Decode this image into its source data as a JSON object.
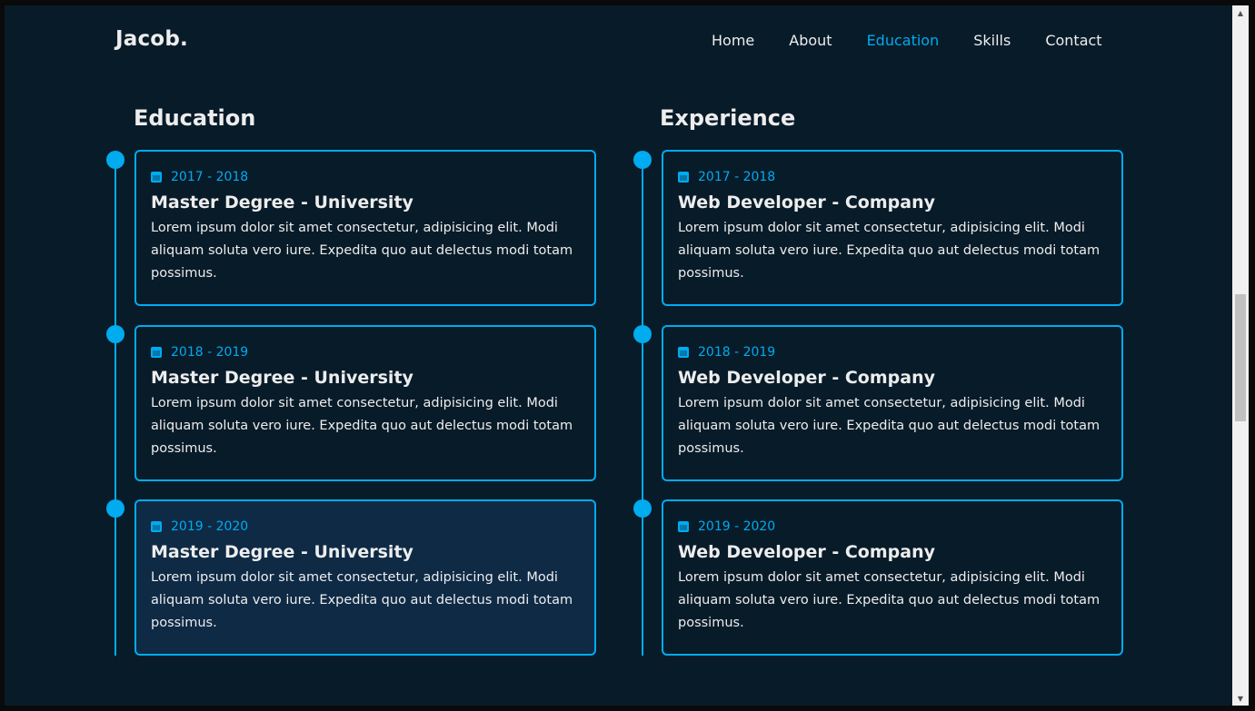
{
  "header": {
    "logo": "Jacob.",
    "nav": [
      "Home",
      "About",
      "Education",
      "Skills",
      "Contact"
    ],
    "active": "Education"
  },
  "education": {
    "title": "Education",
    "items": [
      {
        "year": "2017 - 2018",
        "title": "Master Degree - University",
        "desc": "Lorem ipsum dolor sit amet consectetur, adipisicing elit. Modi aliquam soluta vero iure. Expedita quo aut delectus modi totam possimus."
      },
      {
        "year": "2018 - 2019",
        "title": "Master Degree - University",
        "desc": "Lorem ipsum dolor sit amet consectetur, adipisicing elit. Modi aliquam soluta vero iure. Expedita quo aut delectus modi totam possimus."
      },
      {
        "year": "2019 - 2020",
        "title": "Master Degree - University",
        "desc": "Lorem ipsum dolor sit amet consectetur, adipisicing elit. Modi aliquam soluta vero iure. Expedita quo aut delectus modi totam possimus."
      }
    ]
  },
  "experience": {
    "title": "Experience",
    "items": [
      {
        "year": "2017 - 2018",
        "title": "Web Developer - Company",
        "desc": "Lorem ipsum dolor sit amet consectetur, adipisicing elit. Modi aliquam soluta vero iure. Expedita quo aut delectus modi totam possimus."
      },
      {
        "year": "2018 - 2019",
        "title": "Web Developer - Company",
        "desc": "Lorem ipsum dolor sit amet consectetur, adipisicing elit. Modi aliquam soluta vero iure. Expedita quo aut delectus modi totam possimus."
      },
      {
        "year": "2019 - 2020",
        "title": "Web Developer - Company",
        "desc": "Lorem ipsum dolor sit amet consectetur, adipisicing elit. Modi aliquam soluta vero iure. Expedita quo aut delectus modi totam possimus."
      }
    ]
  },
  "colors": {
    "background": "#081b29",
    "accent": "#00abf0",
    "text": "#ededed",
    "card_hover": "#0e2a45"
  },
  "icons": {
    "calendar": "calendar-icon"
  }
}
